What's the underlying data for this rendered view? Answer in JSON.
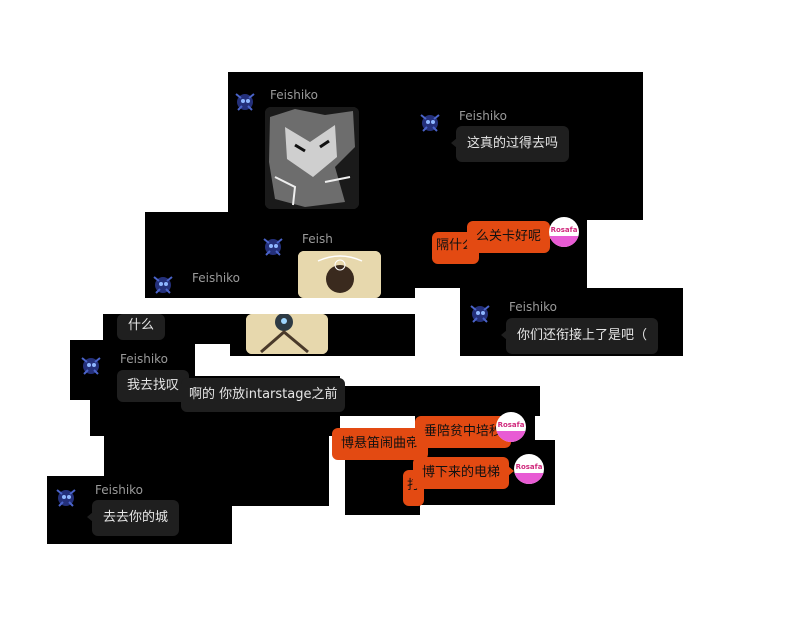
{
  "user_name": "Feishiko",
  "badge_text": "Rosafa",
  "colors": {
    "background": "#ffffff",
    "panel": "#000000",
    "other_bubble": "#1f1f1f",
    "self_bubble": "#e34a12"
  },
  "messages": {
    "m1_name": "Feishiko",
    "m2_name": "Feishiko",
    "m2_text": "这真的过得去吗",
    "m3_text": "么关卡好呢",
    "m3_behind": "隔什么",
    "m4_name": "Feish",
    "m5_name": "Feishiko",
    "m5_text": "什么",
    "m6_name": "Feishiko",
    "m6_text": "你们还衔接上了是吧（",
    "m7_name": "Feishiko",
    "m7_text_a": "我去找叹",
    "m7_text_b": "啊的 你放intarstage之前",
    "m8_text_a": "垂陪贫中培秒",
    "m8_text_b": "博悬笛闹曲帝",
    "m9_text": "博下来的电梯",
    "m9_behind": "打",
    "m10_name": "Feishiko",
    "m10_text": "去去你的城"
  }
}
